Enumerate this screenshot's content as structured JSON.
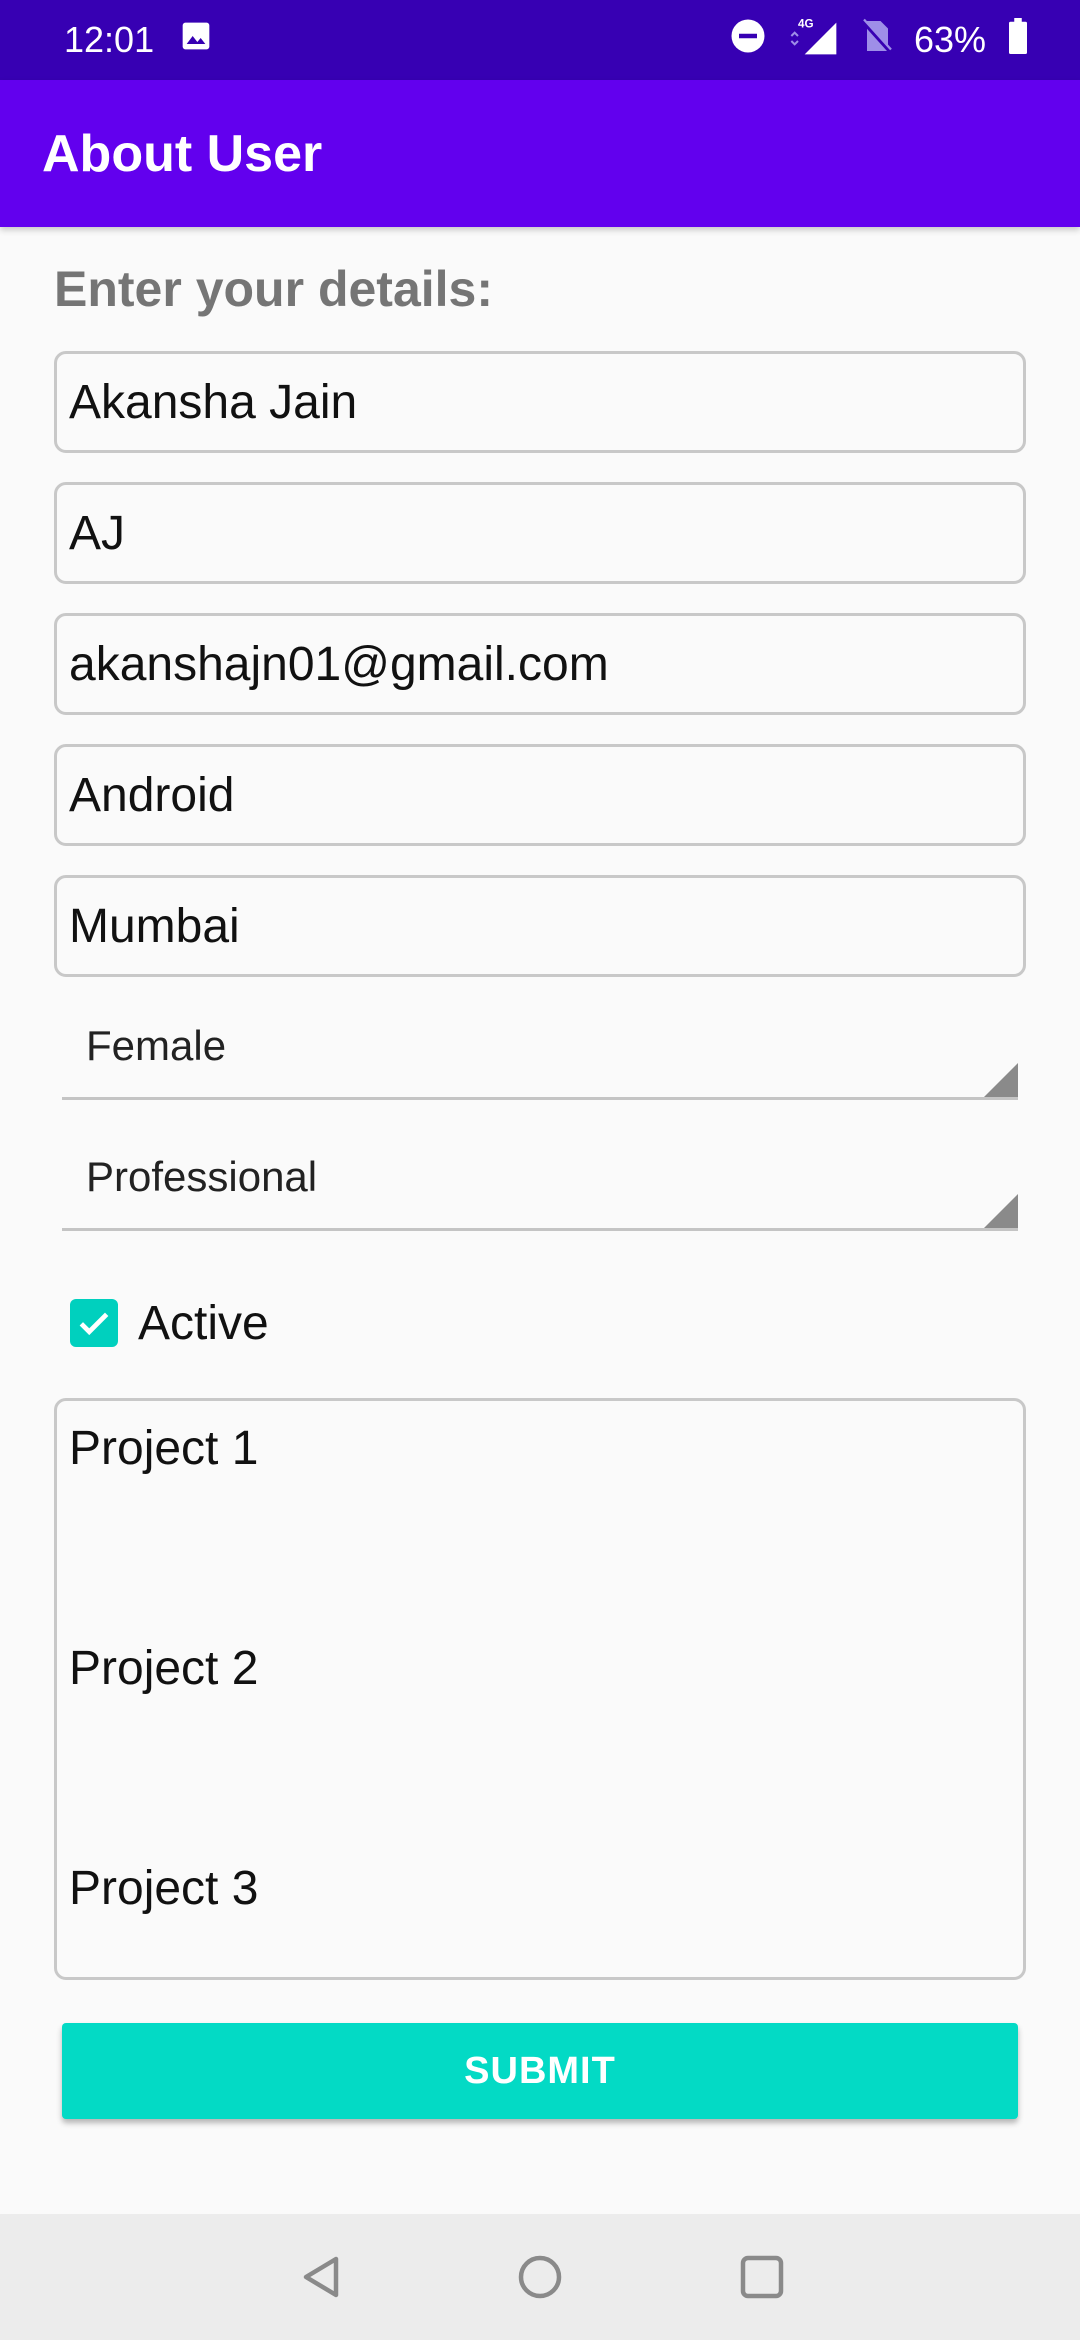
{
  "status_bar": {
    "time": "12:01",
    "network": "4G",
    "battery": "63%",
    "icons": [
      "image-icon",
      "do-not-disturb-icon",
      "signal-icon",
      "no-sim-icon",
      "battery-icon"
    ]
  },
  "app_bar": {
    "title": "About User",
    "color": "#6200ee"
  },
  "form": {
    "heading": "Enter your details:",
    "fields": [
      {
        "name": "name",
        "value": "Akansha Jain"
      },
      {
        "name": "nickname",
        "value": "AJ"
      },
      {
        "name": "email",
        "value": "akanshajn01@gmail.com"
      },
      {
        "name": "skill",
        "value": "Android"
      },
      {
        "name": "city",
        "value": "Mumbai"
      }
    ],
    "gender_spinner": {
      "selected": "Female"
    },
    "type_spinner": {
      "selected": "Professional"
    },
    "active_checkbox": {
      "label": "Active",
      "checked": true
    },
    "projects": [
      "Project 1",
      "Project 2",
      "Project 3"
    ],
    "submit_label": "SUBMIT",
    "accent_color": "#03dac5"
  },
  "nav_bar": {
    "icons": [
      "back-icon",
      "home-icon",
      "recents-icon"
    ]
  }
}
